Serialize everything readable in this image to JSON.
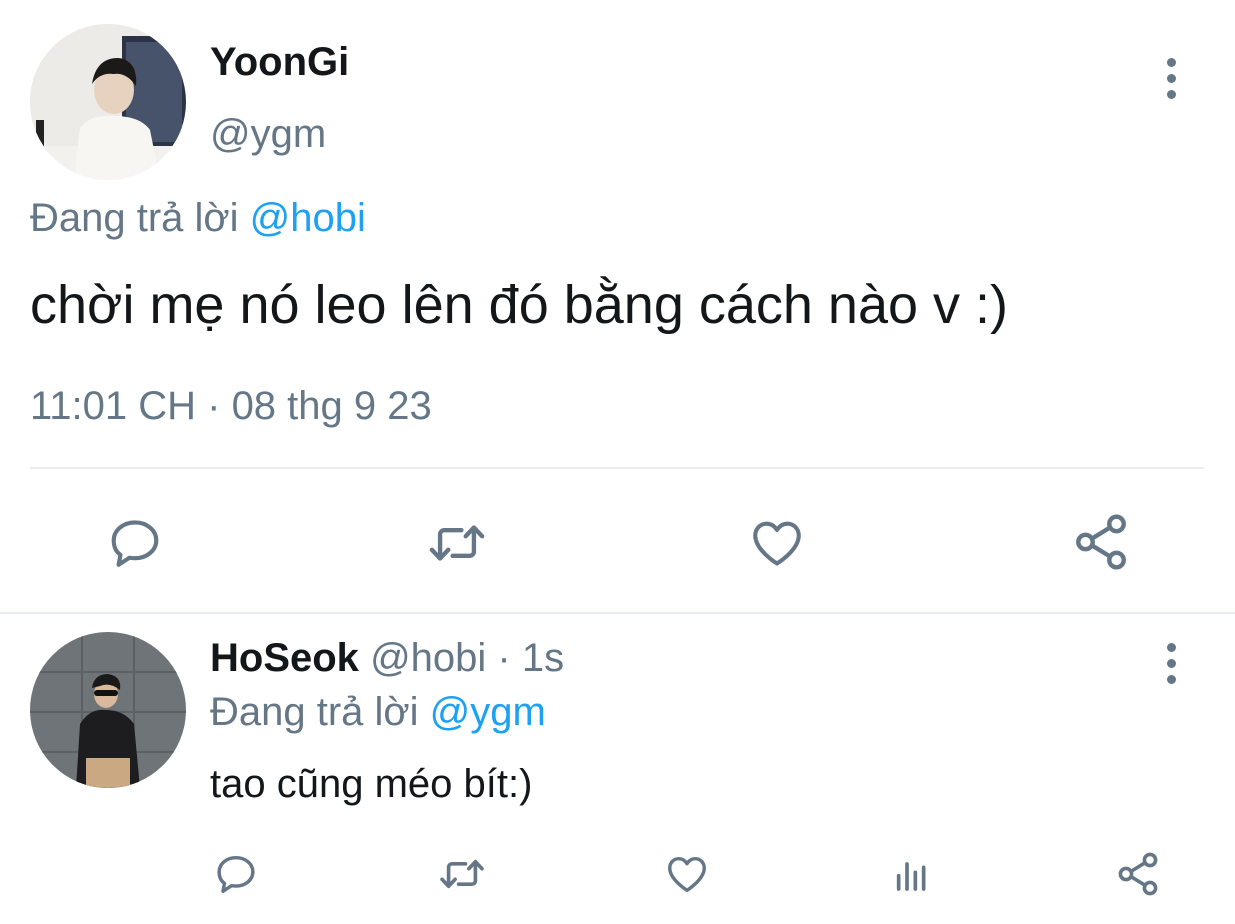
{
  "main_tweet": {
    "author_name": "YoonGi",
    "author_handle": "@ygm",
    "reply_prefix": "Đang trả lời",
    "reply_to": "@hobi",
    "text": "chời mẹ nó leo lên đó bằng cách nào v :)",
    "timestamp": "11:01 CH · 08 thg 9 23",
    "actions": [
      "reply-icon",
      "retweet-icon",
      "like-icon",
      "share-icon"
    ]
  },
  "reply_tweet": {
    "author_name": "HoSeok",
    "author_handle": "@hobi",
    "time_sep": " · ",
    "time": "1s",
    "reply_prefix": "Đang trả lời",
    "reply_to": "@ygm",
    "text": "tao cũng méo bít:)",
    "actions": [
      "reply-icon",
      "retweet-icon",
      "like-icon",
      "analytics-icon",
      "share-icon"
    ]
  },
  "colors": {
    "text": "#14171a",
    "muted": "#657786",
    "link": "#1da1f2",
    "divider": "#e6ecf0"
  }
}
